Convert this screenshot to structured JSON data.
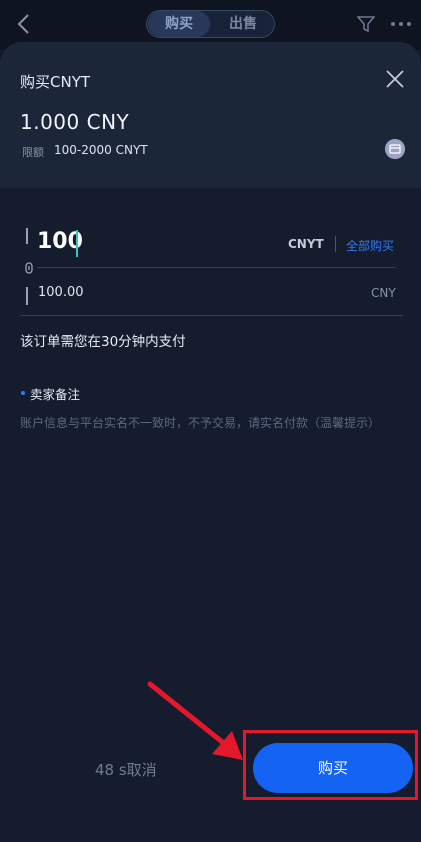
{
  "header": {
    "tabs": [
      {
        "label": "购买",
        "active": true
      },
      {
        "label": "出售",
        "active": false
      }
    ],
    "icons": [
      "back-icon",
      "filter-icon",
      "more-icon"
    ]
  },
  "sheet": {
    "title": "购买CNYT",
    "price": "1.000 CNY",
    "limit_label": "限额",
    "limit_value": "100-2000 CNYT",
    "icons": [
      "close-icon",
      "card-icon"
    ]
  },
  "form": {
    "amount_value": "100",
    "amount_unit": "CNYT",
    "buy_all_label": "全部购买",
    "cny_value": "100.00",
    "cny_unit": "CNY"
  },
  "pay_hint": "该订单需您在30分钟内支付",
  "seller_note": {
    "title": "卖家备注",
    "text": "账户信息与平台实名不一致时，不予交易，请实名付款（温馨提示）"
  },
  "footer": {
    "cancel_label": "48 s取消",
    "buy_label": "购买"
  },
  "colors": {
    "accent": "#1463f3",
    "highlight": "#e5172b",
    "background": "#141c2e"
  }
}
